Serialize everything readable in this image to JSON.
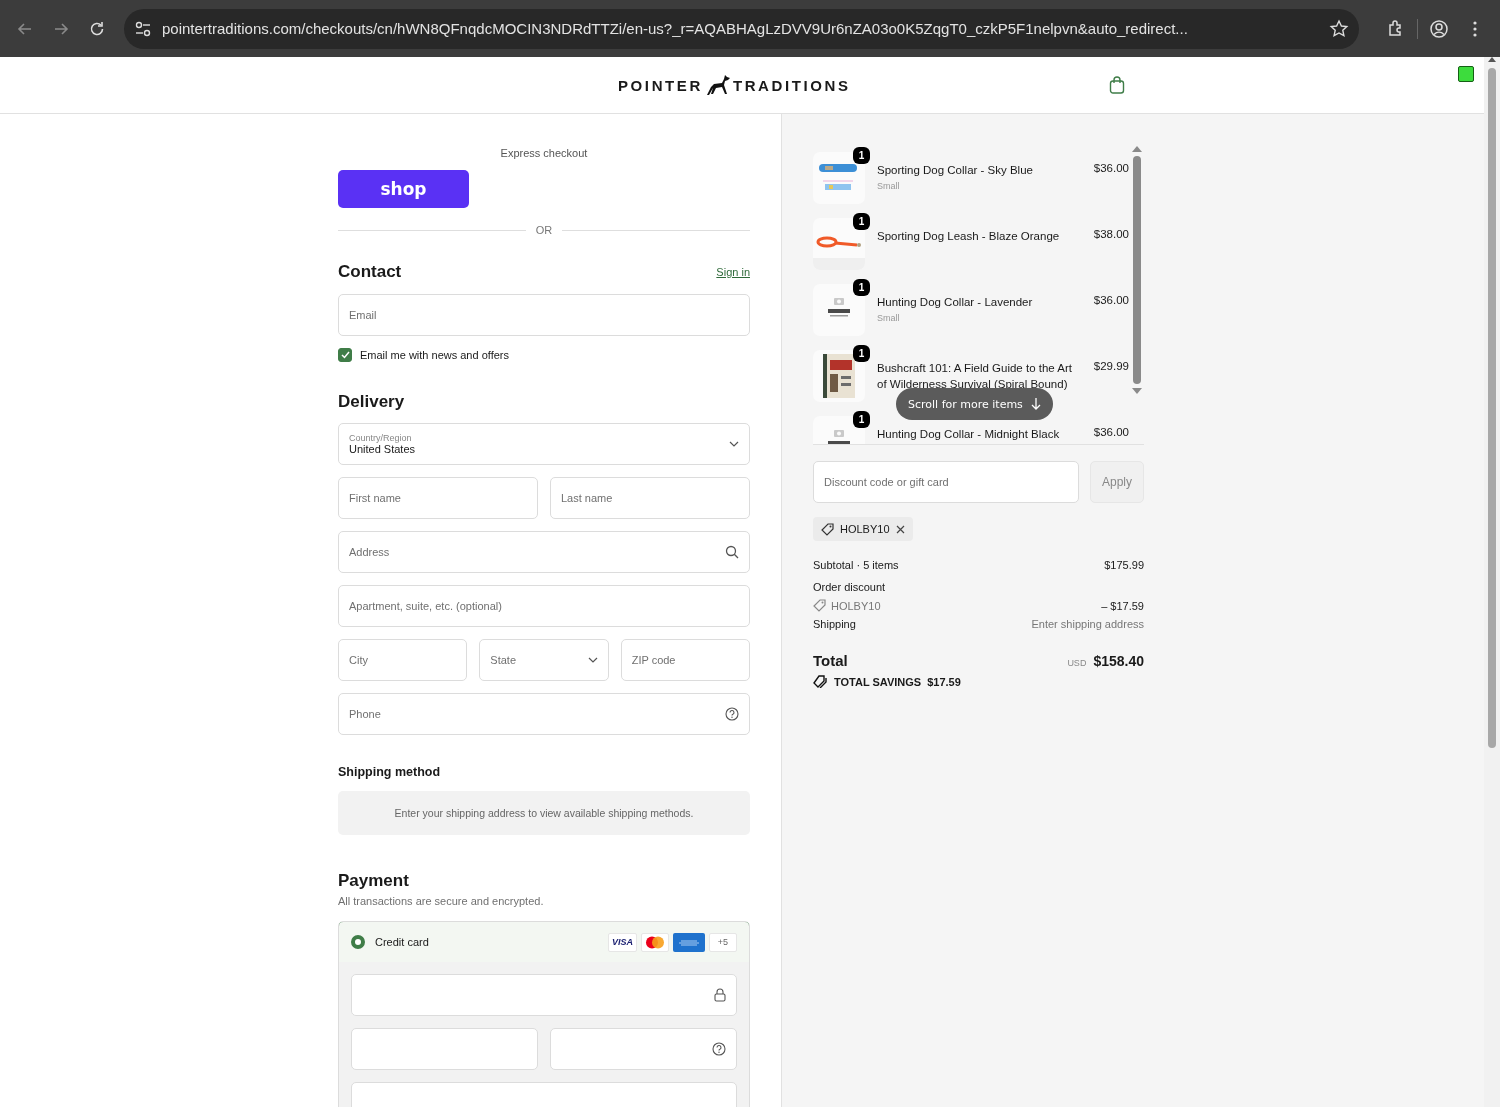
{
  "browser": {
    "url": "pointertraditions.com/checkouts/cn/hWN8QFnqdcMOCIN3NDRdTTZi/en-us?_r=AQABHAgLzDVV9Ur6nZA03o0K5ZqgT0_czkP5F1nelpvn&auto_redirect..."
  },
  "header": {
    "brand_left": "POINTER",
    "brand_right": "TRADITIONS"
  },
  "express": {
    "label": "Express checkout",
    "shop_button": "shop",
    "divider": "OR"
  },
  "contact": {
    "title": "Contact",
    "sign_in": "Sign in",
    "email": {
      "placeholder": "Email"
    },
    "newsletter": {
      "label": "Email me with news and offers",
      "checked": true
    }
  },
  "delivery": {
    "title": "Delivery",
    "rows": [
      [
        {
          "kind": "select",
          "label": "Country/Region",
          "value": "United States"
        }
      ],
      [
        {
          "kind": "text",
          "placeholder": "First name"
        },
        {
          "kind": "text",
          "placeholder": "Last name"
        }
      ],
      [
        {
          "kind": "search",
          "placeholder": "Address"
        }
      ],
      [
        {
          "kind": "text",
          "placeholder": "Apartment, suite, etc. (optional)"
        }
      ],
      [
        {
          "kind": "text",
          "placeholder": "City"
        },
        {
          "kind": "select",
          "placeholder": "State"
        },
        {
          "kind": "text",
          "placeholder": "ZIP code"
        }
      ],
      [
        {
          "kind": "help",
          "placeholder": "Phone"
        }
      ]
    ]
  },
  "shipping_method": {
    "title": "Shipping method",
    "notice": "Enter your shipping address to view available shipping methods."
  },
  "payment": {
    "title": "Payment",
    "subtitle": "All transactions are secure and encrypted.",
    "methods": [
      {
        "label": "Credit card",
        "selected": true,
        "brands": [
          {
            "kind": "visa",
            "label": "VISA"
          },
          {
            "kind": "mastercard"
          },
          {
            "kind": "amex"
          },
          {
            "kind": "more",
            "label": "+5"
          }
        ],
        "rows": [
          [
            {
              "kind": "lock"
            }
          ],
          [
            {
              "kind": "text"
            },
            {
              "kind": "help"
            }
          ],
          [
            {
              "kind": "text"
            }
          ]
        ]
      }
    ]
  },
  "order": {
    "items": [
      {
        "quantity": "1",
        "name": "Sporting Dog Collar - Sky Blue",
        "variant": "Small",
        "price": "$36.00"
      },
      {
        "quantity": "1",
        "name": "Sporting Dog Leash - Blaze Orange",
        "price": "$38.00"
      },
      {
        "quantity": "1",
        "name": "Hunting Dog Collar - Lavender",
        "variant": "Small",
        "price": "$36.00"
      },
      {
        "quantity": "1",
        "name": "Bushcraft 101: A Field Guide to the Art of Wilderness Survival (Spiral Bound)",
        "price": "$29.99"
      },
      {
        "quantity": "1",
        "name": "Hunting Dog Collar - Midnight Black",
        "price": "$36.00"
      }
    ],
    "scroll_hint": "Scroll for more items",
    "discount": {
      "placeholder": "Discount code or gift card",
      "apply": "Apply",
      "disabled": true
    },
    "applied_codes": [
      {
        "code": "HOLBY10"
      }
    ],
    "summary": {
      "subtotal_label": "Subtotal · 5 items",
      "subtotal": "$175.99",
      "discount_label": "Order discount",
      "discount_code": "HOLBY10",
      "discount_amount": "– $17.59",
      "shipping_label": "Shipping",
      "shipping_value": "Enter shipping address",
      "total_label": "Total",
      "currency": "USD",
      "total": "$158.40",
      "savings_label": "TOTAL SAVINGS",
      "savings": "$17.59"
    }
  }
}
